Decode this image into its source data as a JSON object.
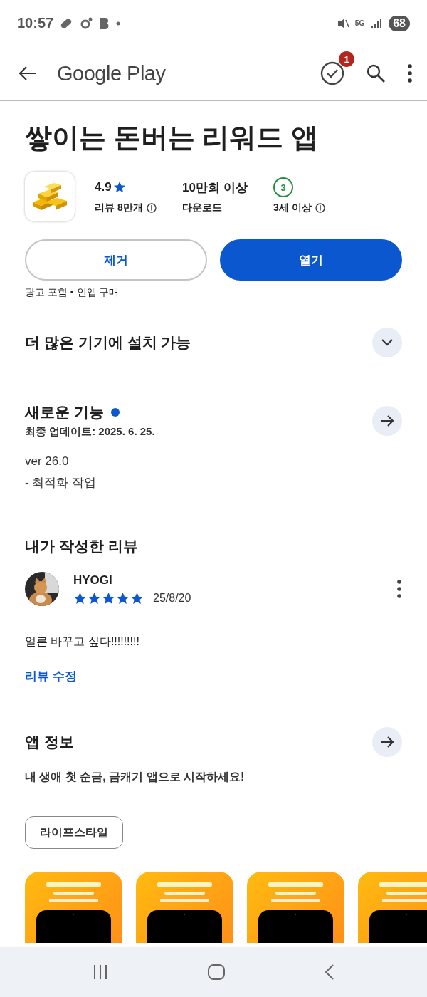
{
  "status_bar": {
    "time": "10:57",
    "network": "5G",
    "battery": "68"
  },
  "app_bar": {
    "title": "Google Play",
    "notification_count": "1"
  },
  "app": {
    "title": "쌓이는 돈버는 리워드 앱",
    "stats": [
      {
        "kind": "rating",
        "value": "4.9",
        "label": "리뷰 8만개",
        "info": true
      },
      {
        "kind": "plain",
        "value": "10만회 이상",
        "label": "다운로드",
        "info": false
      },
      {
        "kind": "age",
        "value": "3",
        "label": "3세 이상",
        "info": true
      }
    ],
    "buttons": [
      {
        "label": "제거",
        "primary": false
      },
      {
        "label": "열기",
        "primary": true
      }
    ],
    "notice": "광고 포함 • 인앱 구매"
  },
  "devices": {
    "title": "더 많은 기기에 설치 가능",
    "expanded": false
  },
  "whats_new": {
    "title": "새로운 기능",
    "new": true,
    "updated": "최종 업데이트: 2025. 6. 25.",
    "lines": [
      "ver 26.0",
      "- 최적화 작업"
    ]
  },
  "my_review": {
    "title": "내가 작성한 리뷰",
    "author": "HYOGI",
    "stars": 5,
    "date": "25/8/20",
    "text": "얼른 바꾸고 싶다!!!!!!!!!",
    "edit_link": "리뷰 수정"
  },
  "about": {
    "title": "앱 정보",
    "description": "내 생애 첫 순금, 금캐기 앱으로 시작하세요!",
    "chips": [
      "라이프스타일"
    ]
  }
}
